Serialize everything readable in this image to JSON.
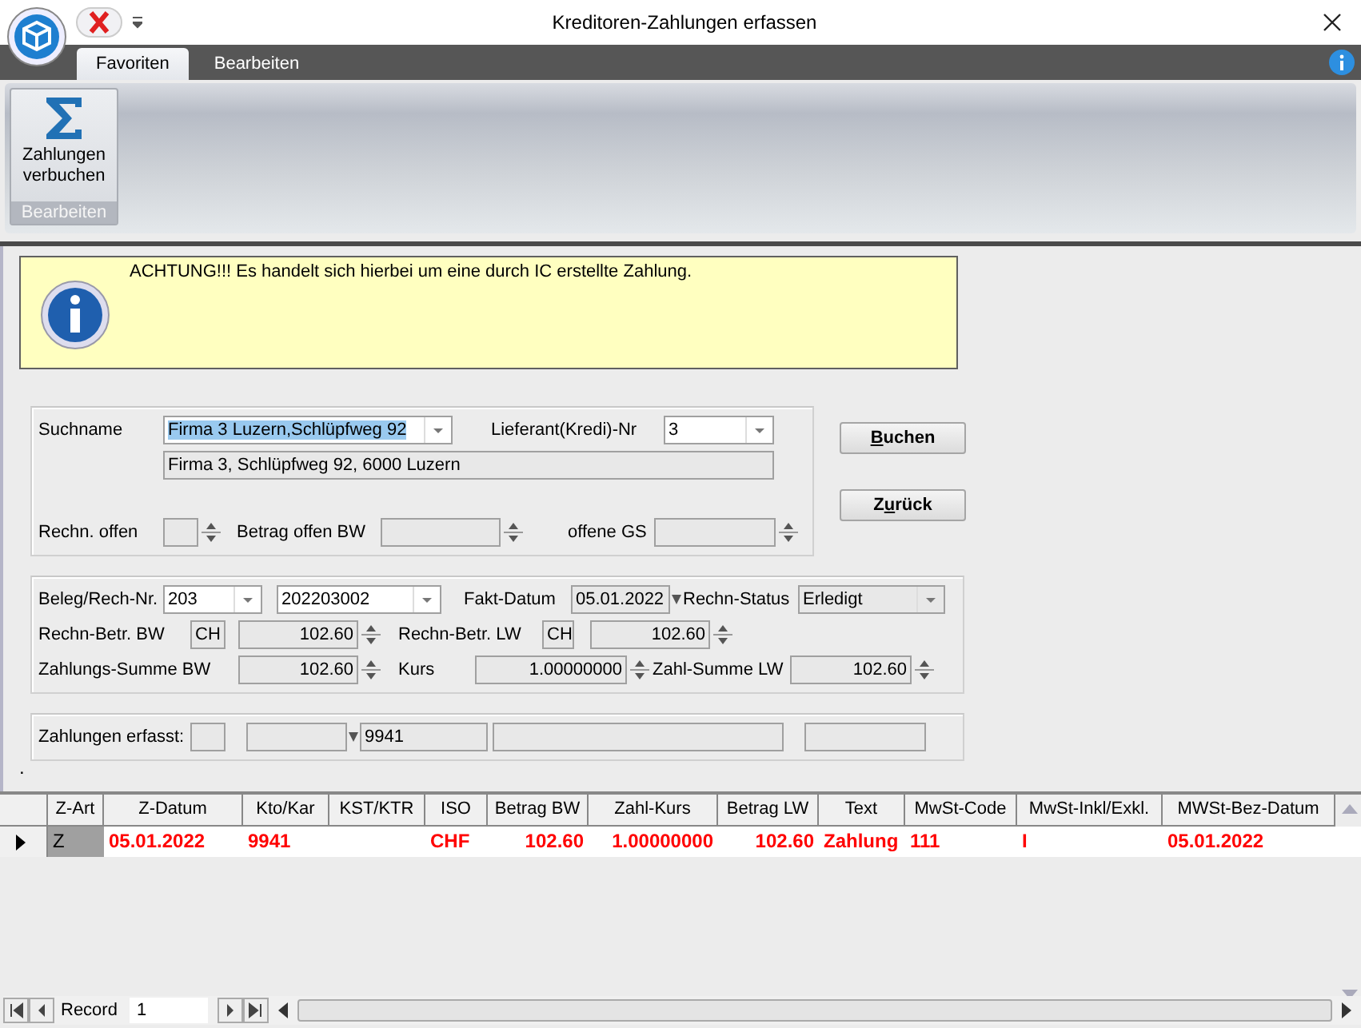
{
  "window": {
    "title": "Kreditoren-Zahlungen erfassen"
  },
  "ribbon": {
    "tabs": [
      {
        "label": "Favoriten",
        "selected": true
      },
      {
        "label": "Bearbeiten",
        "selected": false
      }
    ],
    "group": {
      "label": "Bearbeiten",
      "button": "Zahlungen verbuchen"
    }
  },
  "notice": {
    "text": "ACHTUNG!!! Es handelt sich hierbei um eine durch IC erstellte Zahlung."
  },
  "search": {
    "suchname_label": "Suchname",
    "suchname": "Firma 3 Luzern,Schlüpfweg 92",
    "suchname_selected": true,
    "lieferant_label": "Lieferant(Kredi)-Nr",
    "lieferant": "3",
    "address": "Firma 3, Schlüpfweg 92, 6000 Luzern",
    "rechn_offen_label": "Rechn. offen",
    "betrag_offen_label": "Betrag offen BW",
    "offene_gs_label": "offene GS"
  },
  "buttons": [
    {
      "key": "B",
      "rest": "uchen"
    },
    {
      "prefix": "Z",
      "key": "u",
      "rest": "rück"
    }
  ],
  "beleg": {
    "beleg_label": "Beleg/Rech-Nr.",
    "beleg": "203",
    "rechnr": "202203002",
    "fakt_label": "Fakt-Datum",
    "fakt": "05.01.2022",
    "status_label": "Rechn-Status",
    "status": "Erledigt",
    "bw_label": "Rechn-Betr. BW",
    "bw_currency": "CH",
    "bw": "102.60",
    "lw_label": "Rechn-Betr. LW",
    "lw_currency": "CH",
    "lw": "102.60",
    "sum_bw_label": "Zahlungs-Summe BW",
    "sum_bw": "102.60",
    "kurs_label": "Kurs",
    "kurs": "1.00000000",
    "sum_lw_label": "Zahl-Summe LW",
    "sum_lw": "102.60"
  },
  "erfasst": {
    "label": "Zahlungen erfasst:",
    "konto": "9941"
  },
  "stray_mark": ".",
  "table": {
    "columns": [
      "Z-Art",
      "Z-Datum",
      "Kto/Kar",
      "KST/KTR",
      "ISO",
      "Betrag BW",
      "Zahl-Kurs",
      "Betrag LW",
      "Text",
      "MwSt-Code",
      "MwSt-Inkl/Exkl.",
      "MWSt-Bez-Datum"
    ],
    "rows": [
      {
        "current": true,
        "cells": [
          "Z",
          "05.01.2022",
          "9941",
          "",
          "CHF",
          "102.60",
          "1.00000000",
          "102.60",
          "Zahlung",
          "111",
          "I",
          "05.01.2022"
        ]
      }
    ]
  },
  "navigator": {
    "label": "Record",
    "value": "1"
  }
}
